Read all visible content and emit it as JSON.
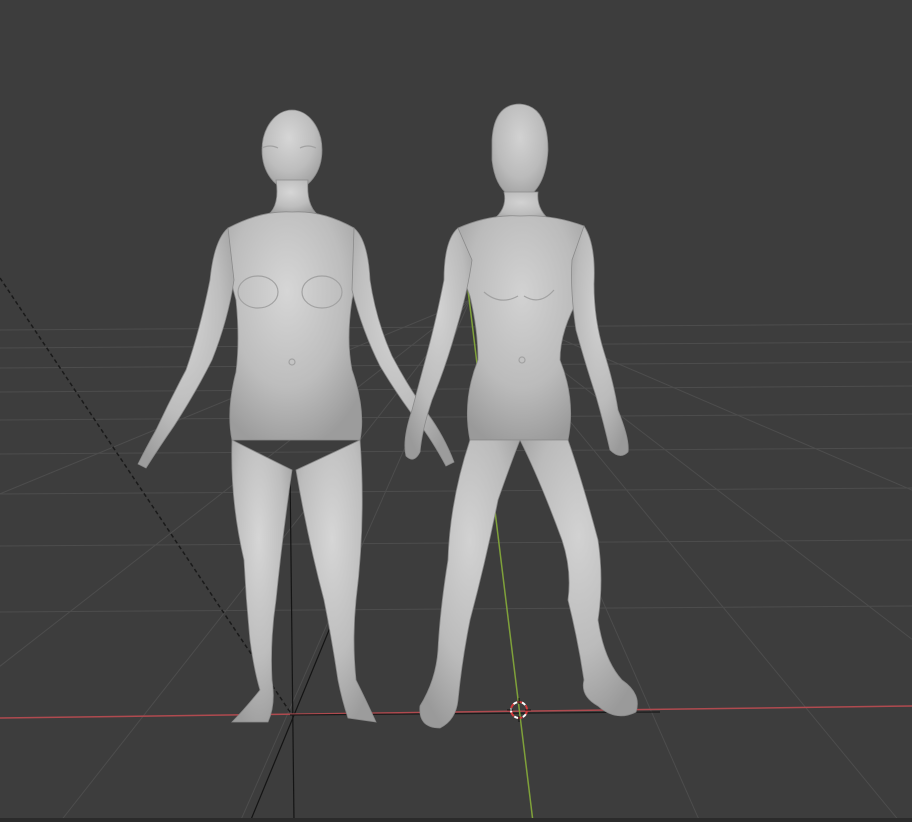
{
  "viewport": {
    "mode": "3d-viewport",
    "background_color": "#3d3d3d",
    "grid_color": "#525252",
    "x_axis_color": "#b04a4f",
    "y_axis_color": "#7fa13a",
    "object_color": "#c8c8c8"
  },
  "objects": [
    {
      "name": "detailed-female-figure",
      "icon": "mesh-figure"
    },
    {
      "name": "low-detail-female-figure",
      "icon": "mesh-figure"
    }
  ],
  "cursor_3d": {
    "icon": "3d-cursor-icon",
    "colors": [
      "#d33b3b",
      "#ffffff"
    ]
  },
  "camera_guides": {
    "style": "dashed"
  }
}
